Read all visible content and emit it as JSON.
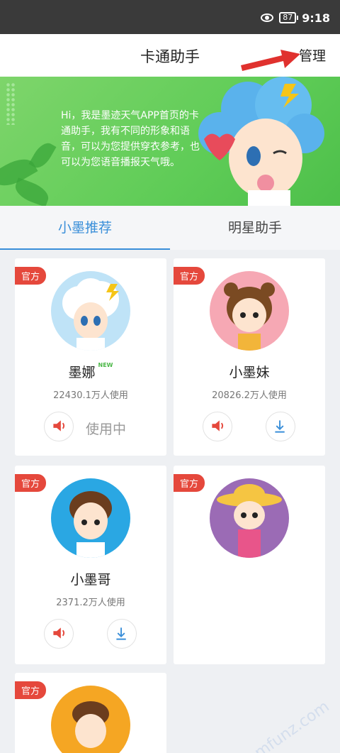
{
  "status_bar": {
    "battery": "87",
    "time": "9:18"
  },
  "nav": {
    "title": "卡通助手",
    "manage_label": "管理"
  },
  "banner": {
    "text": "Hi，我是墨迹天气APP首页的卡通助手，我有不同的形象和语音，可以为您提供穿衣参考，也可以为您语音播报天气哦。"
  },
  "tabs": [
    {
      "label": "小墨推荐"
    },
    {
      "label": "明星助手"
    }
  ],
  "cards": [
    {
      "badge": "官方",
      "name": "墨娜",
      "tag": "NEW",
      "users": "22430.1万人使用",
      "status": "使用中"
    },
    {
      "badge": "官方",
      "name": "小墨妹",
      "users": "20826.2万人使用"
    },
    {
      "badge": "官方",
      "name": "小墨哥",
      "users": "2371.2万人使用"
    },
    {
      "badge": "官方"
    },
    {
      "badge": "官方"
    }
  ],
  "colors": {
    "accent": "#3a8fd9",
    "badge": "#e5483c",
    "banner": "#5fcc57"
  },
  "watermark": "mfunz.com"
}
